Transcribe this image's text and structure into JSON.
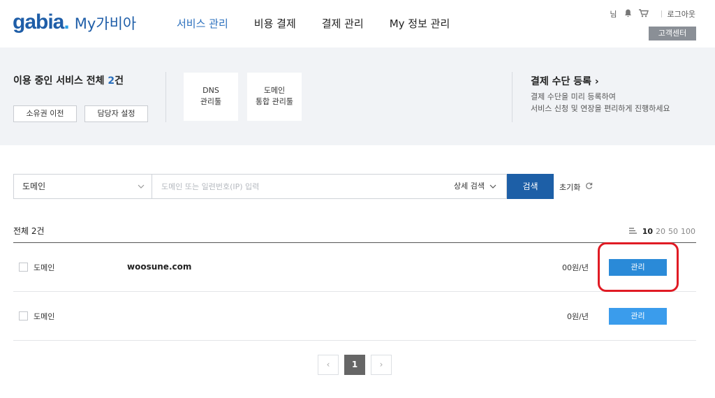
{
  "header": {
    "logo_word": "gabia",
    "logo_dot": ".",
    "logo_sub": "My가비아",
    "nav": [
      "서비스 관리",
      "비용 결제",
      "결제 관리",
      "My 정보 관리"
    ],
    "user_suffix": "님",
    "logout": "로그아웃",
    "customer_center": "고객센터"
  },
  "summary": {
    "title_prefix": "이용 중인 서비스 전체 ",
    "count": "2",
    "count_suffix": "건",
    "transfer_btn": "소유권 이전",
    "manager_btn": "담당자 설정",
    "tool_dns_line1": "DNS",
    "tool_dns_line2": "관리툴",
    "tool_domain_line1": "도메인",
    "tool_domain_line2": "통합 관리툴",
    "pay_title": "결제 수단 등록 ›",
    "pay_desc_line1": "결제 수단을 미리 등록하여",
    "pay_desc_line2": "서비스 신청 및 연장을 편리하게 진행하세요"
  },
  "search": {
    "category": "도메인",
    "placeholder": "도메인 또는 일련번호(IP) 입력",
    "detail": "상세 검색",
    "button": "검색",
    "reset": "초기화"
  },
  "list": {
    "total": "전체 2건",
    "page_sizes": [
      "10",
      "20",
      "50",
      "100"
    ],
    "rows": [
      {
        "type": "도메인",
        "domain": "woosune.com",
        "price": "00원/년",
        "action": "관리"
      },
      {
        "type": "도메인",
        "domain": "",
        "price": "0원/년",
        "action": "관리"
      }
    ]
  },
  "pagination": {
    "prev": "‹",
    "current": "1",
    "next": "›"
  },
  "colors": {
    "brand": "#1f5ea8",
    "search_button": "#1d5fa7",
    "manage_button": "#2a8ad8",
    "highlight": "#e01b24"
  }
}
